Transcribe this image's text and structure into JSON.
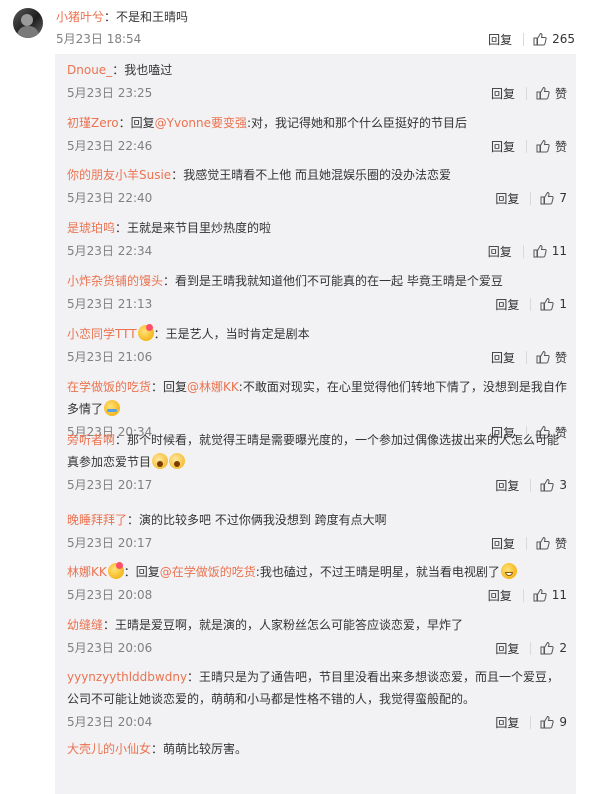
{
  "main_comment": {
    "user": "小猪叶兮",
    "text": "：不是和王晴吗",
    "time": "5月23日 18:54",
    "reply_label": "回复",
    "like_count": "265"
  },
  "replies": [
    {
      "user": "Dnoue_",
      "text": "：我也嗑过",
      "time": "5月23日 23:25",
      "reply_label": "回复",
      "like": "赞"
    },
    {
      "user": "初瑾Zero",
      "pre": "：回复",
      "mention": "@Yvonne要变强",
      "text": ":对，我记得她和那个什么臣挺好的节目后",
      "time": "5月23日 22:46",
      "reply_label": "回复",
      "like": "赞"
    },
    {
      "user": "你的朋友小羊Susie",
      "text": "：我感觉王晴看不上他 而且她混娱乐圈的没办法恋爱",
      "time": "5月23日 22:40",
      "reply_label": "回复",
      "like": "7"
    },
    {
      "user": "是琥珀呜",
      "text": "：王就是来节目里炒热度的啦",
      "time": "5月23日 22:34",
      "reply_label": "回复",
      "like": "11"
    },
    {
      "user": "小炸杂货铺的馒头",
      "text": "：看到是王晴我就知道他们不可能真的在一起  毕竟王晴是个爱豆",
      "time": "5月23日 21:13",
      "reply_label": "回复",
      "like": "1"
    },
    {
      "user": "小恋同学TTT",
      "emoji_after_name": "heart",
      "text": "：王是艺人，当时肯定是剧本",
      "time": "5月23日 21:06",
      "reply_label": "回复",
      "like": "赞"
    },
    {
      "user": "在学做饭的吃货",
      "pre": "：回复",
      "mention": "@林娜KK",
      "text": ":不敢面对现实，在心里觉得他们转地下情了，没想到是我自作多情了",
      "emoji_end": "cry",
      "time": "5月23日 20:34",
      "reply_label": "回复",
      "like": "赞"
    },
    {
      "user": "旁听者啊",
      "text": "：那个时候看，就觉得王晴是需要曝光度的，一个参加过偶像选拔出来的人怎么可能真参加恋爱节目",
      "emoji_end": "shock",
      "emoji_end2": "shock",
      "time": "5月23日 20:17",
      "reply_label": "回复",
      "like": "3"
    },
    {
      "user": "晚睡拜拜了",
      "text": "：演的比较多吧 不过你俩我没想到 跨度有点大啊",
      "time": "5月23日 20:17",
      "reply_label": "回复",
      "like": "赞"
    },
    {
      "user": "林娜KK",
      "emoji_after_name": "heart",
      "pre": "：回复",
      "mention": "@在学做饭的吃货",
      "text": ":我也磕过，不过王晴是明星，就当看电视剧了",
      "emoji_end": "grin",
      "time": "5月23日 20:08",
      "reply_label": "回复",
      "like": "11"
    },
    {
      "user": "幼缝缝",
      "text": "：王晴是爱豆啊，就是演的，人家粉丝怎么可能答应谈恋爱，早炸了",
      "time": "5月23日 20:06",
      "reply_label": "回复",
      "like": "2"
    },
    {
      "user": "yyynzyythlddbwdny",
      "text": "：王晴只是为了通告吧，节目里没看出来多想谈恋爱，而且一个爱豆，公司不可能让她谈恋爱的，萌萌和小马都是性格不错的人，我觉得蛮般配的。",
      "time": "5月23日 20:04",
      "reply_label": "回复",
      "like": "9"
    },
    {
      "user": "大壳儿的小仙女",
      "text": "：萌萌比较厉害。",
      "time": "",
      "reply_label": "",
      "like": ""
    }
  ]
}
